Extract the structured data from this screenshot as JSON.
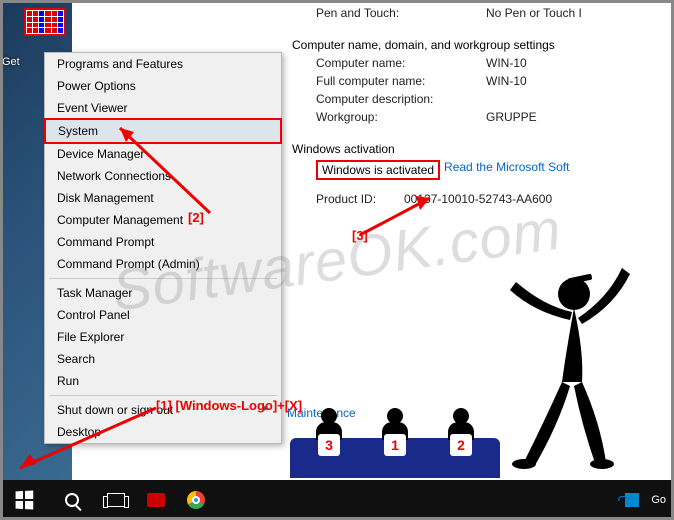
{
  "desktop": {
    "icon_label": "Get"
  },
  "menu": {
    "items": [
      {
        "label": "Programs and Features",
        "arrow": false
      },
      {
        "label": "Power Options",
        "arrow": false
      },
      {
        "label": "Event Viewer",
        "arrow": false
      },
      {
        "label": "System",
        "arrow": false,
        "selected": true
      },
      {
        "label": "Device Manager",
        "arrow": false
      },
      {
        "label": "Network Connections",
        "arrow": false
      },
      {
        "label": "Disk Management",
        "arrow": false
      },
      {
        "label": "Computer Management",
        "arrow": false
      },
      {
        "label": "Command Prompt",
        "arrow": false
      },
      {
        "label": "Command Prompt (Admin)",
        "arrow": false
      }
    ],
    "items2": [
      {
        "label": "Task Manager",
        "arrow": false
      },
      {
        "label": "Control Panel",
        "arrow": false
      },
      {
        "label": "File Explorer",
        "arrow": false
      },
      {
        "label": "Search",
        "arrow": false
      },
      {
        "label": "Run",
        "arrow": false
      }
    ],
    "items3": [
      {
        "label": "Shut down or sign out",
        "arrow": true
      },
      {
        "label": "Desktop",
        "arrow": false
      }
    ]
  },
  "system": {
    "pen_touch_label": "Pen and Touch:",
    "pen_touch_value": "No Pen or Touch I",
    "section_name": "Computer name, domain, and workgroup settings",
    "computer_name_label": "Computer name:",
    "computer_name_value": "WIN-10",
    "full_name_label": "Full computer name:",
    "full_name_value": "WIN-10",
    "description_label": "Computer description:",
    "description_value": "",
    "workgroup_label": "Workgroup:",
    "workgroup_value": "GRUPPE",
    "activation_section": "Windows activation",
    "activation_status": "Windows is activated",
    "activation_link": "Read the Microsoft Soft",
    "product_id_label": "Product ID:",
    "product_id_value": "00137-10010-52743-AA600",
    "maintenance_link": "Maintenance"
  },
  "annotations": {
    "a1": "[1] [Windows-Logo]+[X]",
    "a2": "[2]",
    "a3": "[3]"
  },
  "taskbar": {
    "go_text": "Go"
  },
  "judges": [
    "3",
    "1",
    "2"
  ],
  "watermark": "SoftwareOK.com"
}
